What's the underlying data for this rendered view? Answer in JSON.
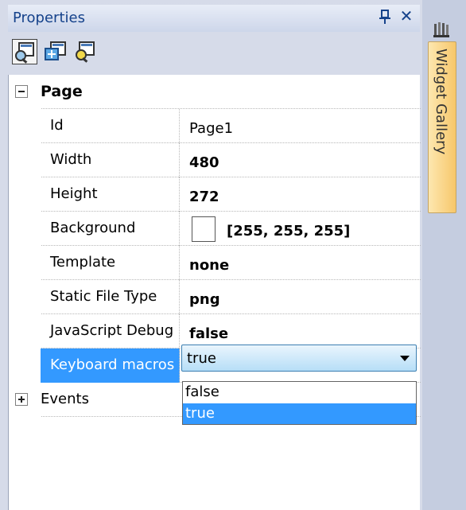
{
  "panel": {
    "title": "Properties",
    "pin_glyph": "ф",
    "close_glyph": "✕",
    "toolbar": [
      {
        "name": "properties-view-icon",
        "active": true
      },
      {
        "name": "events-view-icon",
        "active": false
      },
      {
        "name": "categorized-view-icon",
        "active": false
      }
    ]
  },
  "grid": {
    "category": {
      "label": "Page",
      "expander": "minus"
    },
    "rows": [
      {
        "name": "Id",
        "value": "Page1",
        "bold": false
      },
      {
        "name": "Width",
        "value": "480",
        "bold": true
      },
      {
        "name": "Height",
        "value": "272",
        "bold": true
      },
      {
        "name": "Background",
        "value": "[255, 255, 255]",
        "bold": true,
        "swatch": "#ffffff"
      },
      {
        "name": "Template",
        "value": "none",
        "bold": true
      },
      {
        "name": "Static File Type",
        "value": "png",
        "bold": true
      },
      {
        "name": "JavaScript Debug",
        "value": "false",
        "bold": true
      },
      {
        "name": "Keyboard macros",
        "value": "",
        "bold": false,
        "selected": true
      }
    ],
    "events": {
      "label": "Events",
      "expander": "plus"
    }
  },
  "combo": {
    "value": "true",
    "options": [
      "false",
      "true"
    ],
    "selected_index": 1
  },
  "side": {
    "tab_label": "Widget Gallery",
    "icon": "widget-gallery-icon"
  },
  "colors": {
    "selection": "#3399ff",
    "title_text": "#15428b",
    "tab_gradient_start": "#fde7b0",
    "tab_gradient_end": "#f7c76a"
  }
}
